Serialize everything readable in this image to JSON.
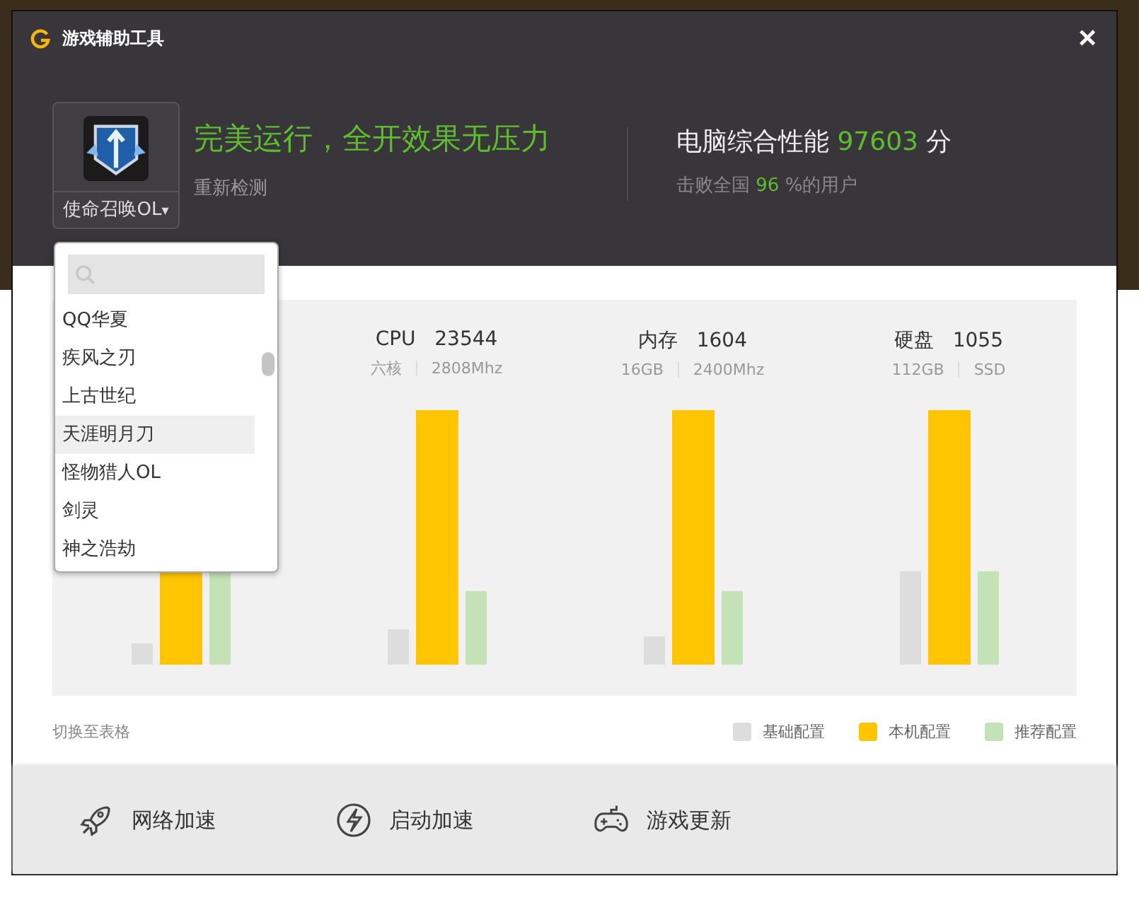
{
  "window": {
    "title": "游戏辅助工具",
    "close": "×"
  },
  "game": {
    "name": "使命召唤OL",
    "caret": "▾"
  },
  "status": {
    "headline": "完美运行，全开效果无压力",
    "recheck": "重新检测"
  },
  "score": {
    "label": "电脑综合性能",
    "value": "97603",
    "unit": "分",
    "rank_prefix": "击败全国",
    "rank_value": "96",
    "rank_suffix": "%的用户"
  },
  "specs": [
    {
      "name": "CPU",
      "value": "23544",
      "detail_1": "六核",
      "detail_2": "2808Mhz"
    },
    {
      "name": "内存",
      "value": "1604",
      "detail_1": "16GB",
      "detail_2": "2400Mhz"
    },
    {
      "name": "硬盘",
      "value": "1055",
      "detail_1": "112GB",
      "detail_2": "SSD"
    }
  ],
  "dropdown": {
    "items": [
      {
        "label": "QQ华夏",
        "selected": false
      },
      {
        "label": "疾风之刃",
        "selected": false
      },
      {
        "label": "上古世纪",
        "selected": false
      },
      {
        "label": "天涯明月刀",
        "selected": true
      },
      {
        "label": "怪物猎人OL",
        "selected": false
      },
      {
        "label": "剑灵",
        "selected": false
      },
      {
        "label": "神之浩劫",
        "selected": false
      }
    ]
  },
  "switch_link": "切换至表格",
  "legend": [
    {
      "label": "基础配置",
      "color": "#dddddd"
    },
    {
      "label": "本机配置",
      "color": "#ffc600"
    },
    {
      "label": "推荐配置",
      "color": "#c3e2b5"
    }
  ],
  "bottom_actions": [
    {
      "label": "网络加速",
      "kind": "rocket"
    },
    {
      "label": "启动加速",
      "kind": "bolt"
    },
    {
      "label": "游戏更新",
      "kind": "gamepad"
    }
  ]
}
